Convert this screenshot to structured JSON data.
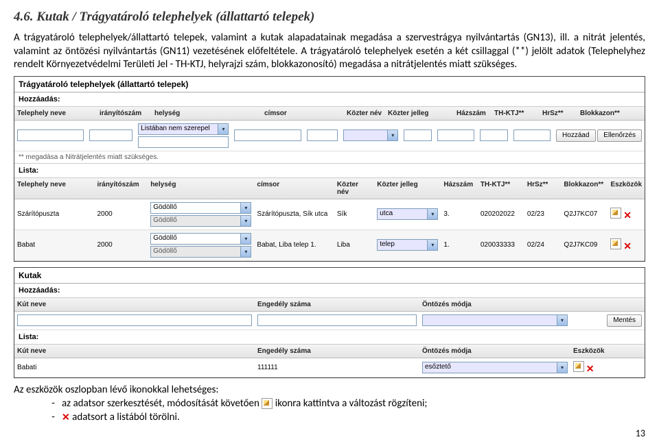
{
  "heading": "4.6.  Kutak / Trágyatároló telephelyek (állattartó telepek)",
  "intro": "A trágyatároló telephelyek/állattartó telepek, valamint a kutak alapadatainak megadása a szervestrágya nyilvántartás (GN13), ill. a nitrát jelentés, valamint az öntözési nyilvántartás (GN11) vezetésének előfeltétele. A trágyatároló telephelyek esetén a két csillaggal (**) jelölt adatok (Telephelyhez rendelt Környezetvédelmi Területi Jel - TH-KTJ, helyrajzi szám, blokkazonosító) megadása a nitrátjelentés miatt szükséges.",
  "telep": {
    "title": "Trágyatároló telephelyek (állattartó telepek)",
    "hozzaadas_label": "Hozzáadás:",
    "lista_label": "Lista:",
    "cols": {
      "tel": "Telephely neve",
      "ir": "irányítószám",
      "hely": "helység",
      "cim": "címsor",
      "ktnev": "Közter név",
      "ktjel": "Közter jelleg",
      "haz": "Házszám",
      "thktj": "TH-KTJ**",
      "hrsz": "HrSz**",
      "blokk": "Blokkazon**",
      "eszk": "Eszközök"
    },
    "add": {
      "hely_placeholder": "Listában nem szerepel",
      "ktjel_placeholder": "",
      "btn_hozzaad": "Hozzáad",
      "btn_ellen": "Ellenőrzés"
    },
    "note": "** megadása a Nitrátjelentés miatt szükséges.",
    "rows": [
      {
        "tel": "Szárítópuszta",
        "ir": "2000",
        "hely1": "Gödöllő",
        "hely2": "Gödöllő",
        "cim": "Szárítópuszta, Sík utca",
        "ktnev": "Sík",
        "ktjel": "utca",
        "haz": "3.",
        "thktj": "020202022",
        "hrsz": "02/23",
        "blokk": "Q2J7KC07"
      },
      {
        "tel": "Babat",
        "ir": "2000",
        "hely1": "Gödöllő",
        "hely2": "Gödöllő",
        "cim": "Babat, Liba telep 1.",
        "ktnev": "Liba",
        "ktjel": "telep",
        "haz": "1.",
        "thktj": "020033333",
        "hrsz": "02/24",
        "blokk": "Q2J7KC09"
      }
    ]
  },
  "kutak": {
    "title": "Kutak",
    "hozzaadas_label": "Hozzáadás:",
    "lista_label": "Lista:",
    "cols": {
      "nev": "Kút neve",
      "eng": "Engedély száma",
      "mod": "Öntözés módja",
      "eszk": "Eszközök"
    },
    "btn_mentes": "Mentés",
    "rows": [
      {
        "nev": "Babati",
        "eng": "111111",
        "mod": "esőztető"
      }
    ]
  },
  "outro_lead": "Az eszközök oszlopban lévő ikonokkal lehetséges:",
  "outro_b1a": "az adatsor szerkesztését, módosítását követően ",
  "outro_b1b": "ikonra kattintva a változást rögzíteni;",
  "outro_b2": " adatsort a listából törölni.",
  "pagenum": "13"
}
